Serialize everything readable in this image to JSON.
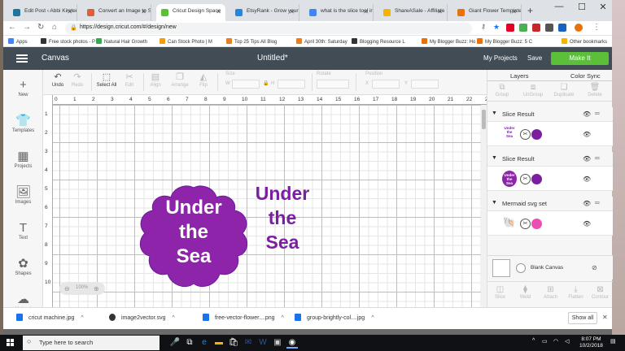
{
  "browser": {
    "tabs": [
      {
        "title": "Edit Post ‹ Abbi Kirsten",
        "color": "#21759b"
      },
      {
        "title": "Convert an Image to SVG",
        "color": "#e35d3a"
      },
      {
        "title": "Cricut Design Space",
        "color": "#5bbf3a",
        "active": true
      },
      {
        "title": "EtsyRank - Grow your",
        "color": "#1e88e5"
      },
      {
        "title": "what is the slice tool in",
        "color": "#4285f4"
      },
      {
        "title": "ShareASale - Affiliate",
        "color": "#f4b400"
      },
      {
        "title": "Giant Flower Template",
        "color": "#e8710a"
      }
    ],
    "url": "https://design.cricut.com/#/design/new",
    "bookmarks": [
      {
        "label": "Apps",
        "color": "#4285f4"
      },
      {
        "label": "Free stock photos - P",
        "color": "#333333"
      },
      {
        "label": "Natural Hair Growth",
        "color": "#34a853"
      },
      {
        "label": "Can Stock Photo | M",
        "color": "#f39c12"
      },
      {
        "label": "Top 25 Tips All Blog",
        "color": "#e67e22"
      },
      {
        "label": "April 30th: Saturday",
        "color": "#e67e22"
      },
      {
        "label": "Blogging Resource L",
        "color": "#333333"
      },
      {
        "label": "My Blogger Buzz: Ho",
        "color": "#e8710a"
      },
      {
        "label": "My Blogger Buzz: 5 C",
        "color": "#e8710a"
      },
      {
        "label": "Other bookmarks",
        "color": "#f4b400"
      }
    ]
  },
  "app": {
    "name": "Canvas",
    "doc_title": "Untitled*",
    "my_projects": "My Projects",
    "save": "Save",
    "make_it": "Make It",
    "left_nav": [
      {
        "label": "New",
        "icon": "+"
      },
      {
        "label": "Templates",
        "icon": "👕"
      },
      {
        "label": "Projects",
        "icon": "▦"
      },
      {
        "label": "Images",
        "icon": "🖼"
      },
      {
        "label": "Text",
        "icon": "T"
      },
      {
        "label": "Shapes",
        "icon": "✿"
      },
      {
        "label": "Upload",
        "icon": "☁"
      }
    ],
    "toolbar": {
      "undo": "Undo",
      "redo": "Redo",
      "select_all": "Select All",
      "edit": "Edit",
      "align": "Align",
      "arrange": "Arrange",
      "flip": "Flip",
      "size": "Size",
      "w": "W",
      "h": "H",
      "rotate": "Rotate",
      "position": "Position",
      "x": "X",
      "y": "Y"
    },
    "ruler_top": [
      "0",
      "1",
      "2",
      "3",
      "4",
      "5",
      "6",
      "7",
      "8",
      "9",
      "10",
      "11",
      "12",
      "13",
      "14",
      "15",
      "16",
      "17",
      "18",
      "19",
      "20",
      "21",
      "22",
      "23"
    ],
    "ruler_left": [
      "1",
      "2",
      "3",
      "4",
      "5",
      "6",
      "7",
      "8",
      "9",
      "10"
    ],
    "zoom": "100%",
    "artwork": {
      "line1": "Under",
      "line2": "the",
      "line3": "Sea",
      "purple": "#8e24aa",
      "text_purple": "#7b1fa2"
    },
    "panel": {
      "tabs": [
        "Layers",
        "Color Sync"
      ],
      "tools": [
        "Group",
        "UnGroup",
        "Duplicate",
        "Delete"
      ],
      "groups": [
        {
          "name": "Slice Result",
          "thumb": "Under the Sea"
        },
        {
          "name": "Slice Result",
          "thumb": "Under the Sea"
        },
        {
          "name": "Mermaid svg set",
          "thumb": ""
        }
      ],
      "blank_canvas": "Blank Canvas",
      "bottom_tools": [
        "Slice",
        "Weld",
        "Attach",
        "Flatten",
        "Contour"
      ]
    }
  },
  "downloads": {
    "files": [
      "cricut machine.jpg",
      "image2vector.svg",
      "free-vector-flower....png",
      "group-brightly-col....jpg"
    ],
    "show_all": "Show all"
  },
  "taskbar": {
    "search_placeholder": "Type here to search",
    "time": "8:07 PM",
    "date": "10/2/2018"
  }
}
